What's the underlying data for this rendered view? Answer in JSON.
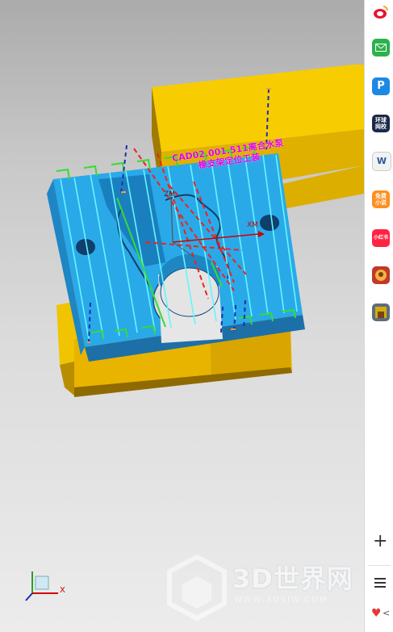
{
  "annotation": {
    "line1": "CAD02.001.511离合水泵",
    "line2": "橡支架定位工装"
  },
  "axis_labels": {
    "x": "XM",
    "z": "ZM"
  },
  "triad": {
    "x_label": "X"
  },
  "watermark": {
    "title": "3D世界网",
    "url": "WWW.3DSJW.COM"
  },
  "sidebar": {
    "apps": [
      {
        "name": "weibo",
        "label": ""
      },
      {
        "name": "message",
        "label": ""
      },
      {
        "name": "pp",
        "label": ""
      },
      {
        "name": "huanqiu",
        "label": "环球 网校"
      },
      {
        "name": "word",
        "label": ""
      },
      {
        "name": "novel",
        "label": "免费 小说"
      },
      {
        "name": "xiaohongshu",
        "label": "小红书"
      },
      {
        "name": "game1",
        "label": ""
      },
      {
        "name": "game2",
        "label": ""
      }
    ],
    "add_label": "+",
    "fav_label": "<"
  },
  "colors": {
    "body_yellow": "#f5c800",
    "fixture_blue": "#29a9e6",
    "toolpath_cyan": "#5ef0ff",
    "toolpath_green": "#33dd33",
    "toolpath_red": "#ee2222",
    "toolpath_navy": "#1a2eb4",
    "annotation_magenta": "#e000e0"
  }
}
